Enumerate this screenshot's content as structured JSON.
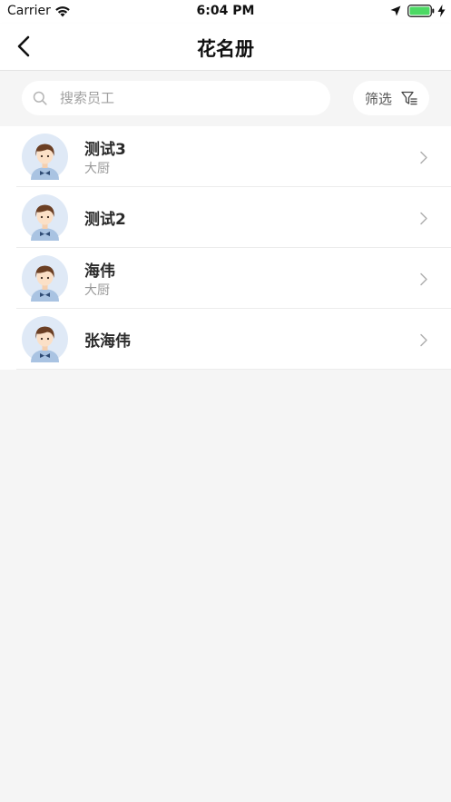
{
  "status_bar": {
    "carrier": "Carrier",
    "time": "6:04 PM",
    "icons": [
      "wifi-icon",
      "location-icon",
      "battery-icon",
      "charging-icon"
    ],
    "battery_color": "#4cd964"
  },
  "nav": {
    "title": "花名册",
    "back_icon": "chevron-left-icon"
  },
  "search": {
    "placeholder": "搜索员工",
    "value": "",
    "icon": "search-icon"
  },
  "filter": {
    "label": "筛选",
    "icon": "filter-icon"
  },
  "employees": [
    {
      "name": "测试3",
      "role": "大厨"
    },
    {
      "name": "测试2",
      "role": ""
    },
    {
      "name": "海伟",
      "role": "大厨"
    },
    {
      "name": "张海伟",
      "role": ""
    }
  ],
  "colors": {
    "background": "#f5f5f5",
    "card": "#ffffff",
    "avatar_bg": "#dfe9f6",
    "divider": "#ececec"
  }
}
